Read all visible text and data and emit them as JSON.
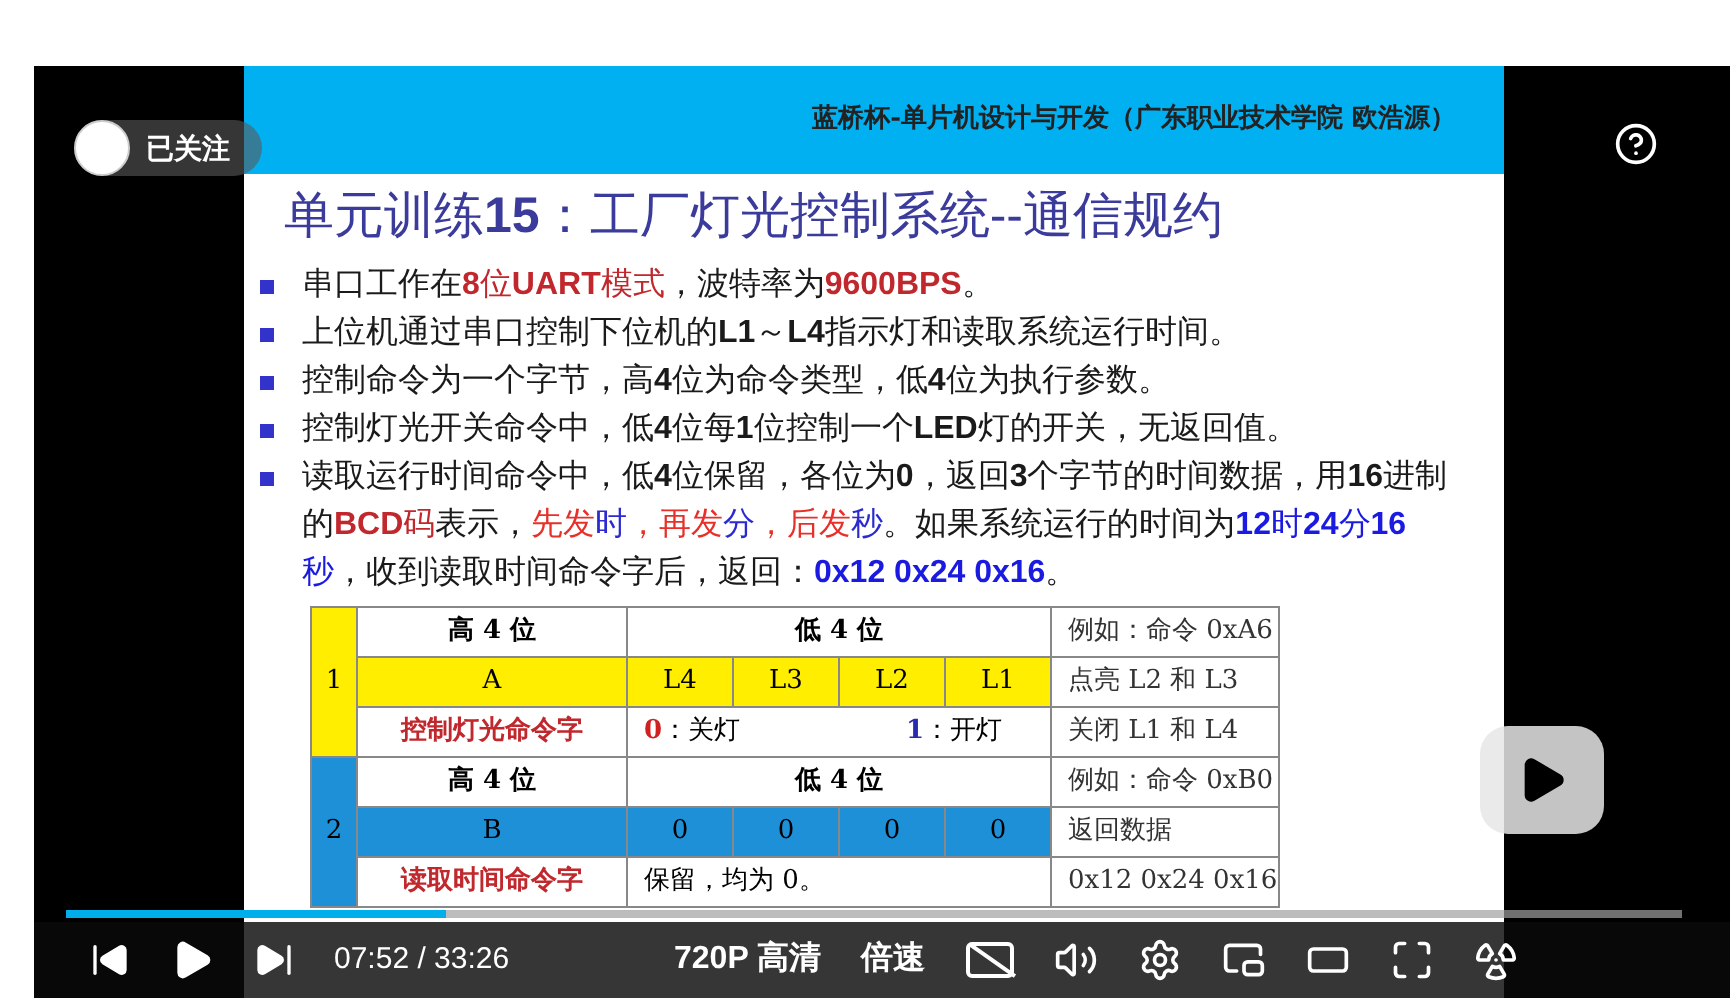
{
  "player": {
    "follow_label": "已关注",
    "time": "07:52 / 33:26",
    "quality": "720P 高清",
    "speed": "倍速",
    "subtitles": {
      "on": false
    },
    "progress": {
      "level": 0.235
    }
  },
  "slide": {
    "header": "蓝桥杯-单片机设计与开发（广东职业技术学院 欧浩源）",
    "title": "单元训练**15**：工厂灯光控制系统--通信规约",
    "bullets": [
      {
        "segments": [
          {
            "text": "串口工作在"
          },
          {
            "text": "**8**位**UART**模式",
            "color": "#c0282d"
          },
          {
            "text": "，波特率为"
          },
          {
            "text": "**9600BPS**",
            "color": "#c0282d"
          },
          {
            "text": "。"
          }
        ]
      },
      {
        "segments": [
          {
            "text": "上位机通过串口控制下位机的**L1**～**L4**指示灯和读取系统运行时间。"
          }
        ]
      },
      {
        "segments": [
          {
            "text": "控制命令为一个字节，高**4**位为命令类型，低**4**位为执行参数。"
          }
        ]
      },
      {
        "segments": [
          {
            "text": "控制灯光开关命令中，低**4**位每**1**位控制一个**LED**灯的开关，无返回值。"
          }
        ]
      },
      {
        "segments": [
          {
            "text": "读取运行时间命令中，低**4**位保留，各位为**0**，返回**3**个字节的时间数据，用**16**进制的"
          },
          {
            "text": "**BCD**码",
            "color": "#c0282d"
          },
          {
            "text": "表示，"
          },
          {
            "text": "先发",
            "color": "#e8302a"
          },
          {
            "text": "时",
            "color": "#2a2ad0"
          },
          {
            "text": "，再发",
            "color": "#e8302a"
          },
          {
            "text": "分",
            "color": "#2a2ad0"
          },
          {
            "text": "，后发",
            "color": "#e8302a"
          },
          {
            "text": "秒",
            "color": "#2a2ad0"
          },
          {
            "text": "。如果系统运行的时间为"
          },
          {
            "text": "**12**时**24**分**16**秒",
            "color": "#1a1ae0"
          },
          {
            "text": "，收到读取时间命令字后，返回："
          },
          {
            "text": "**0x12 0x24 0x16**",
            "color": "#1a1ae0"
          },
          {
            "text": "。"
          }
        ]
      }
    ],
    "table": {
      "sections": [
        {
          "number": "1",
          "color": "#ffee00",
          "rows": [
            {
              "kind": "header",
              "high": "高 4 位",
              "low": "低 4 位",
              "note": "例如：命令 0xA6"
            },
            {
              "kind": "bits",
              "high": "A",
              "bits": [
                "L4",
                "L3",
                "L2",
                "L1"
              ],
              "note": "点亮 L2 和 L3"
            },
            {
              "kind": "legend",
              "high": "控制灯光命令字",
              "parts": [
                {
                  "key": "0",
                  "label": "：关灯",
                  "color": "#d02020"
                },
                {
                  "key": "1",
                  "label": "：开灯",
                  "color": "#2a2ab0"
                }
              ],
              "note": "关闭 L1 和 L4"
            }
          ]
        },
        {
          "number": "2",
          "color": "#1e90d8",
          "rows": [
            {
              "kind": "header",
              "high": "高 4 位",
              "low": "低 4 位",
              "note": "例如：命令 0xB0"
            },
            {
              "kind": "bits",
              "high": "B",
              "bits": [
                "0",
                "0",
                "0",
                "0"
              ],
              "note": "返回数据"
            },
            {
              "kind": "remark",
              "high": "读取时间命令字",
              "text": "保留，均为 0。",
              "note": "0x12 0x24 0x16"
            }
          ]
        }
      ]
    }
  }
}
